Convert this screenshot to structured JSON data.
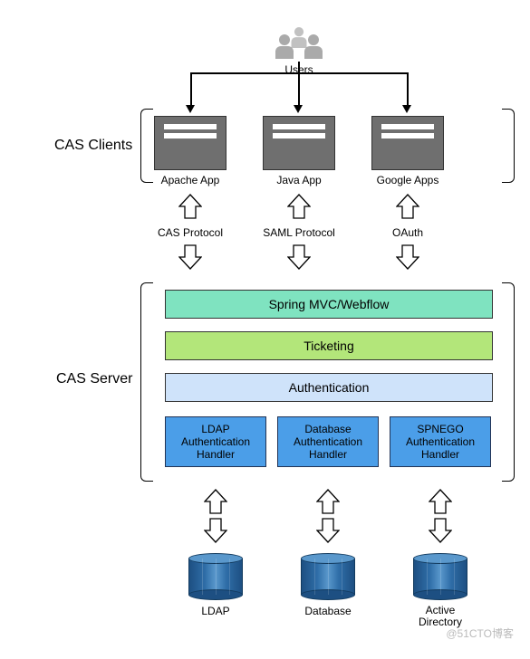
{
  "users": {
    "label": "Users"
  },
  "sections": {
    "clients_label": "CAS Clients",
    "server_label": "CAS Server"
  },
  "clients": {
    "apache": {
      "label": "Apache App"
    },
    "java": {
      "label": "Java App"
    },
    "google": {
      "label": "Google Apps"
    }
  },
  "protocols": {
    "apache": "CAS Protocol",
    "java": "SAML Protocol",
    "google": "OAuth"
  },
  "server": {
    "layers": {
      "spring": "Spring MVC/Webflow",
      "ticketing": "Ticketing",
      "auth": "Authentication"
    },
    "handlers": {
      "ldap": {
        "line1": "LDAP",
        "line2": "Authentication",
        "line3": "Handler"
      },
      "db": {
        "line1": "Database",
        "line2": "Authentication",
        "line3": "Handler"
      },
      "spnego": {
        "line1": "SPNEGO",
        "line2": "Authentication",
        "line3": "Handler"
      }
    }
  },
  "databases": {
    "ldap": "LDAP",
    "db": "Database",
    "ad": {
      "line1": "Active",
      "line2": "Directory"
    }
  },
  "watermark": "@51CTO博客"
}
